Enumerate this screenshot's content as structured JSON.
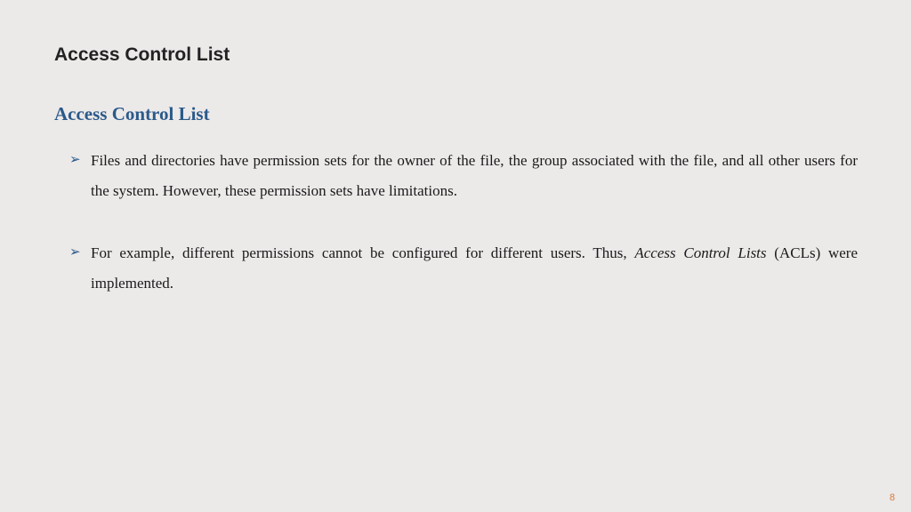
{
  "main_title": "Access Control List",
  "sub_title": "Access Control List",
  "bullets": [
    {
      "text": "Files and directories have permission sets for the owner of the file, the group associated with the file, and all other users for the system. However, these permission sets have limitations."
    },
    {
      "text_prefix": "For example, different permissions cannot be configured for different users. Thus, ",
      "italic_part": "Access Control Lists",
      "text_suffix": " (ACLs) were implemented."
    }
  ],
  "page_number": "8",
  "colors": {
    "background": "#ece9e9",
    "title": "#222",
    "subtitle": "#2a5a8a",
    "bullet_marker": "#2a5a8a",
    "body_text": "#1a1a1a",
    "page_number": "#d47a3a"
  }
}
